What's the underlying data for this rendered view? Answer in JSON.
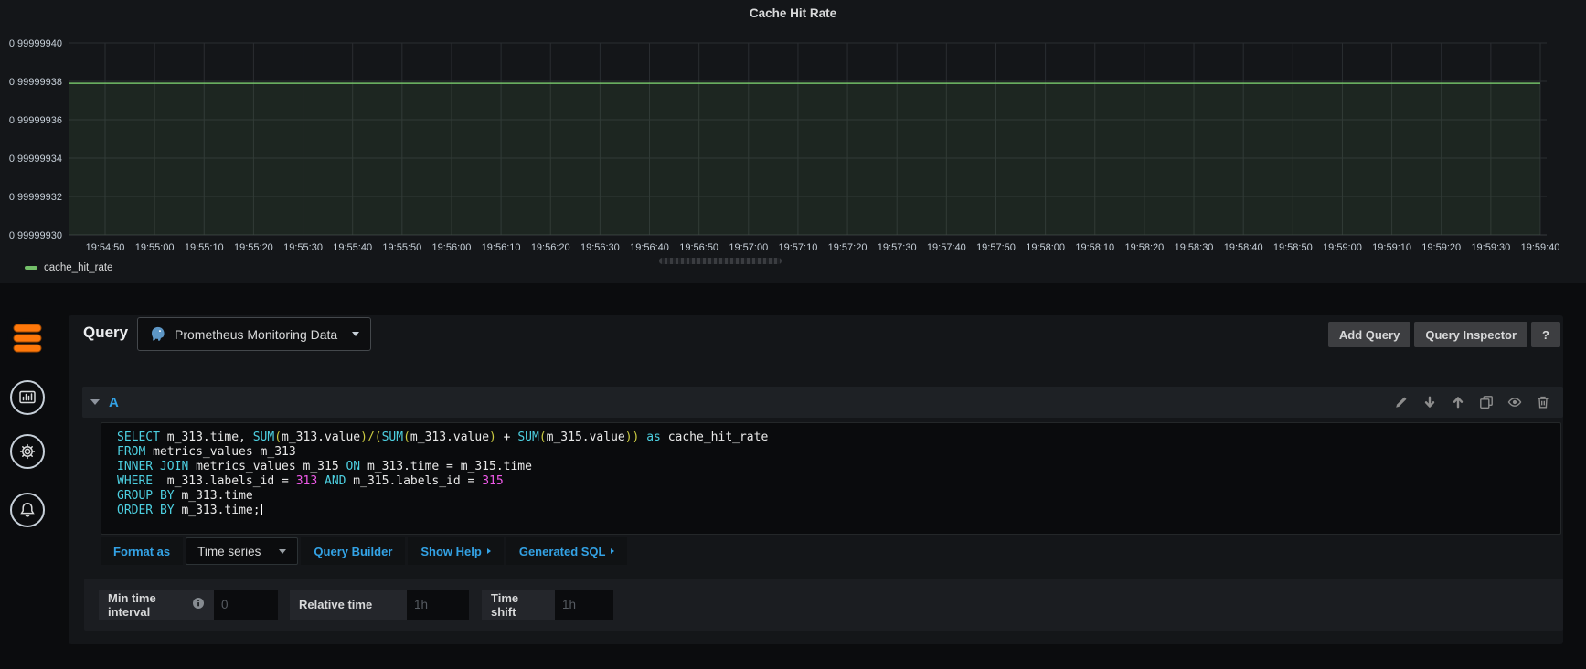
{
  "colors": {
    "background": "#0b0c0e",
    "panel": "#141619",
    "accent_blue": "#33a2e5",
    "series_green": "#73bf69",
    "sql_keyword": "#4dd0e1",
    "sql_number": "#ef59e8",
    "sql_paren": "#cbcb41",
    "datasource_orange": "#ff780a",
    "text": "#d8d9da"
  },
  "chart_panel": {
    "chart_data": {
      "type": "line",
      "title": "Cache Hit Rate",
      "xlabel": "",
      "ylabel": "",
      "grid": true,
      "legend_position": "bottom-left",
      "ylim": [
        0.9999993,
        0.9999994
      ],
      "y_ticks": [
        "0.99999940",
        "0.99999938",
        "0.99999936",
        "0.99999934",
        "0.99999932",
        "0.99999930"
      ],
      "x_ticks": [
        "19:54:50",
        "19:55:00",
        "19:55:10",
        "19:55:20",
        "19:55:30",
        "19:55:40",
        "19:55:50",
        "19:56:00",
        "19:56:10",
        "19:56:20",
        "19:56:30",
        "19:56:40",
        "19:56:50",
        "19:57:00",
        "19:57:10",
        "19:57:20",
        "19:57:30",
        "19:57:40",
        "19:57:50",
        "19:58:00",
        "19:58:10",
        "19:58:20",
        "19:58:30",
        "19:58:40",
        "19:58:50",
        "19:59:00",
        "19:59:10",
        "19:59:20",
        "19:59:30",
        "19:59:40"
      ],
      "x_tick_interval_seconds": 10,
      "series": [
        {
          "name": "cache_hit_rate",
          "color": "#73bf69",
          "constant_value": 0.999999379,
          "fill_below": true
        }
      ]
    }
  },
  "sidebar": {
    "tabs": [
      {
        "id": "queries",
        "icon": "database-icon",
        "active": true
      },
      {
        "id": "visualization",
        "icon": "bar-chart-icon",
        "active": false
      },
      {
        "id": "general",
        "icon": "gear-icon",
        "active": false
      },
      {
        "id": "alert",
        "icon": "bell-icon",
        "active": false
      }
    ]
  },
  "query_section": {
    "title": "Query",
    "datasource_picker": {
      "name": "Prometheus Monitoring Data",
      "icon": "postgresql-elephant-icon"
    },
    "add_query_label": "Add Query",
    "query_inspector_label": "Query Inspector",
    "help_label": "?",
    "query_row": {
      "ref_id": "A",
      "action_icons": [
        "edit-pencil-icon",
        "move-down-icon",
        "move-up-icon",
        "duplicate-icon",
        "eye-icon",
        "trash-icon"
      ]
    },
    "sql": {
      "lines": [
        [
          [
            "k",
            "SELECT"
          ],
          [
            "t",
            " m_313.time, "
          ],
          [
            "k",
            "SUM"
          ],
          [
            "p",
            "("
          ],
          [
            "t",
            "m_313.value"
          ],
          [
            "p",
            ")/("
          ],
          [
            "k",
            "SUM"
          ],
          [
            "p",
            "("
          ],
          [
            "t",
            "m_313.value"
          ],
          [
            "p",
            ")"
          ],
          [
            "t",
            " + "
          ],
          [
            "k",
            "SUM"
          ],
          [
            "p",
            "("
          ],
          [
            "t",
            "m_315.value"
          ],
          [
            "p",
            "))"
          ],
          [
            "t",
            " "
          ],
          [
            "k",
            "as"
          ],
          [
            "t",
            " cache_hit_rate"
          ]
        ],
        [
          [
            "k",
            "FROM"
          ],
          [
            "t",
            " metrics_values m_313"
          ]
        ],
        [
          [
            "k",
            "INNER JOIN"
          ],
          [
            "t",
            " metrics_values m_315 "
          ],
          [
            "k",
            "ON"
          ],
          [
            "t",
            " m_313.time = m_315.time"
          ]
        ],
        [
          [
            "k",
            "WHERE"
          ],
          [
            "t",
            "  m_313.labels_id = "
          ],
          [
            "n",
            "313"
          ],
          [
            "t",
            " "
          ],
          [
            "k",
            "AND"
          ],
          [
            "t",
            " m_315.labels_id = "
          ],
          [
            "n",
            "315"
          ]
        ],
        [
          [
            "k",
            "GROUP BY"
          ],
          [
            "t",
            " m_313.time"
          ]
        ],
        [
          [
            "k",
            "ORDER BY"
          ],
          [
            "t",
            " m_313.time;"
          ],
          [
            "c",
            ""
          ]
        ]
      ]
    },
    "toolbar": {
      "format_as": "Format as",
      "format_value": "Time series",
      "query_builder": "Query Builder",
      "show_help": "Show Help",
      "generated_sql": "Generated SQL"
    },
    "options": [
      {
        "label": "Min time interval",
        "has_info_icon": true,
        "placeholder": "0"
      },
      {
        "label": "Relative time",
        "placeholder": "1h"
      },
      {
        "label": "Time shift",
        "placeholder": "1h"
      }
    ]
  }
}
